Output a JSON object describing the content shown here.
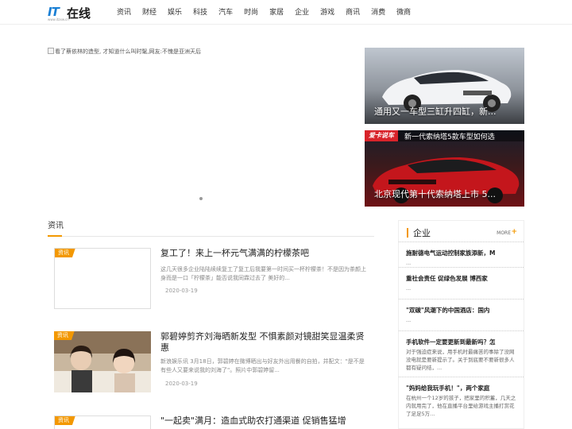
{
  "header": {
    "logo": {
      "mark": "IT",
      "name": "在线",
      "sub": "www.itzxw.cn"
    },
    "nav": [
      "资讯",
      "财经",
      "娱乐",
      "科技",
      "汽车",
      "时尚",
      "家居",
      "企业",
      "游戏",
      "商讯",
      "消费",
      "微商"
    ]
  },
  "hero": {
    "alt_text": "看了蔡依林的造型, 才知道什么叫时髦,网友:不愧是亚洲天后"
  },
  "promos": [
    {
      "caption": "通用又一车型三缸升四缸，新..."
    },
    {
      "badge": "爱卡说车",
      "top_text": "新一代索纳塔5款车型如何选",
      "caption": "北京现代第十代索纳塔上市 5..."
    }
  ],
  "section": {
    "title": "资讯"
  },
  "articles": [
    {
      "tag": "资讯",
      "title": "复工了！来上一杯元气满满的柠檬茶吧",
      "summary": "这几天很多企业陆陆续续复工了复工后我要第一时间买一杯柠檬茶！不是因为茶颜上身而是一口「柠檬茶」能否说我同霖过去了 美好的...",
      "date": "2020-03-19"
    },
    {
      "tag": "资讯",
      "title": "郭碧婷剪齐刘海晒新发型 不惧素颜对镜甜笑显温柔贤惠",
      "summary": "新浪娱乐讯 3月18日，郭碧婷在微博晒出与好友外出用餐的自拍，并配文：\"是不是有些人又要来说我的刘海了\"。照片中郭碧婷留...",
      "date": "2020-03-19"
    },
    {
      "tag": "资讯",
      "title": "\"一起卖\"满月：造血式助农打通渠道 促销售猛增",
      "summary": "",
      "date": ""
    }
  ],
  "sidebar": {
    "title": "企业",
    "more": "MORE",
    "items": [
      {
        "title": "施耐德电气运动控制家族添新，M",
        "desc": "..."
      },
      {
        "title": "重社会责任 促绿色发展 博西家",
        "desc": "..."
      },
      {
        "title": "\"双碳\"风潮下的中国酒店：国内",
        "desc": "..."
      },
      {
        "title": "手机软件一定要更新到最新吗？怎",
        "desc": "对于强迫症来说，用手机时最痛苦的事除了没网没电就是要新提示了。关于到底要不要新很多人都有疑问结，..."
      },
      {
        "title": "\"妈妈给我玩手机！\"，两个家庭",
        "desc": "在杭州一个12岁的孩子，把家里的积蓄，几天之内就用完了，他在直播平台里给游戏主播打赏花了足足5万..."
      }
    ]
  },
  "colors": {
    "accent": "#f39800",
    "logo_blue": "#1a7fd4"
  }
}
